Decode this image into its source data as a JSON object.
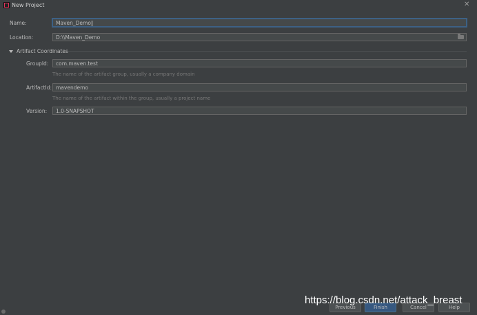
{
  "window": {
    "title": "New Project",
    "close_glyph": "✕"
  },
  "form": {
    "name": {
      "label": "Name:",
      "value": "Maven_Demo"
    },
    "location": {
      "label": "Location:",
      "value": "D:\\\\Maven_Demo",
      "browse_icon": "folder-icon"
    },
    "section": {
      "title": "Artifact Coordinates",
      "expanded": true
    },
    "groupid": {
      "label": "GroupId:",
      "value": "com.maven.test",
      "hint": "The name of the artifact group, usually a company domain"
    },
    "artifactid": {
      "label": "ArtifactId:",
      "value": "mavendemo",
      "hint": "The name of the artifact within the group, usually a project name"
    },
    "version": {
      "label": "Version:",
      "value": "1.0-SNAPSHOT"
    }
  },
  "footer": {
    "buttons": [
      "Previous",
      "Finish",
      "Cancel",
      "Help"
    ],
    "watermark": "https://blog.csdn.net/attack_breast"
  },
  "colors": {
    "background": "#3c3f41",
    "field": "#45494a",
    "focus": "#3d6185",
    "primary_button": "#365880",
    "hint": "#787878"
  }
}
